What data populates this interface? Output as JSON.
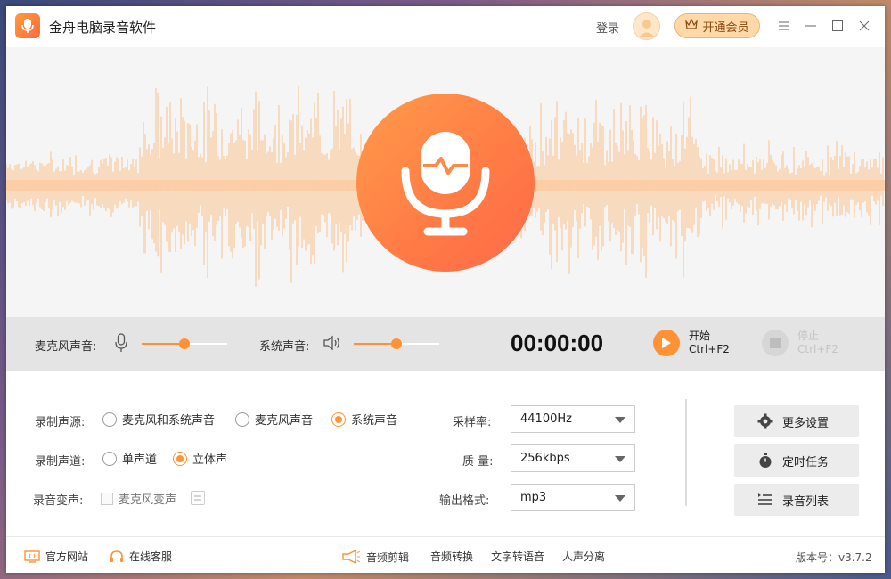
{
  "app": {
    "title": "金舟电脑录音软件"
  },
  "header": {
    "login_label": "登录",
    "vip_label": "开通会员"
  },
  "control": {
    "mic_label": "麦克风声音:",
    "mic_volume": 0.5,
    "system_label": "系统声音:",
    "system_volume": 0.5,
    "timer": "00:00:00",
    "start_label": "开始",
    "start_shortcut": "Ctrl+F2",
    "stop_label": "停止",
    "stop_shortcut": "Ctrl+F2"
  },
  "settings": {
    "source_label": "录制声源:",
    "source_options": [
      "麦克风和系统声音",
      "麦克风声音",
      "系统声音"
    ],
    "source_selected": 2,
    "channel_label": "录制声道:",
    "channel_options": [
      "单声道",
      "立体声"
    ],
    "channel_selected": 1,
    "voice_change_label": "录音变声:",
    "voice_change_checkbox": "麦克风变声",
    "sample_rate_label": "采样率:",
    "sample_rate_value": "44100Hz",
    "quality_label": "质 量:",
    "quality_value": "256kbps",
    "format_label": "输出格式:",
    "format_value": "mp3"
  },
  "side_buttons": {
    "more_settings": "更多设置",
    "scheduled_task": "定时任务",
    "recording_list": "录音列表"
  },
  "footer": {
    "official_site": "官方网站",
    "online_service": "在线客服",
    "audio_edit": "音频剪辑",
    "audio_convert": "音频转换",
    "text_to_speech": "文字转语音",
    "vocal_separation": "人声分离",
    "version": "版本号：v3.7.2"
  },
  "colors": {
    "accent": "#ff9234",
    "wave": "#fcc99a",
    "control_bg": "#e4e4e4"
  }
}
